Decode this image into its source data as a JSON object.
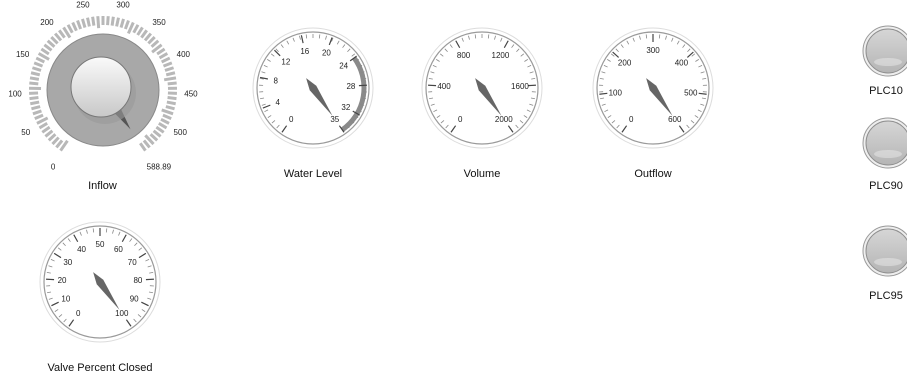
{
  "knob": {
    "caption": "Inflow",
    "min": 0,
    "max": 588.89,
    "value": 588.89,
    "min_label": "0",
    "max_label": "588.89",
    "ticks": [
      "50",
      "100",
      "150",
      "200",
      "250",
      "300",
      "350",
      "400",
      "450",
      "500"
    ]
  },
  "gauges": [
    {
      "caption": "Water Level",
      "min": 0,
      "max": 35,
      "value": 35,
      "ticks": [
        "0",
        "4",
        "8",
        "12",
        "16",
        "20",
        "24",
        "28",
        "32",
        "35"
      ],
      "band": [
        24,
        35
      ]
    },
    {
      "caption": "Volume",
      "min": 0,
      "max": 2000,
      "value": 2000,
      "ticks": [
        "0",
        "400",
        "800",
        "1200",
        "1600",
        "2000"
      ]
    },
    {
      "caption": "Outflow",
      "min": 0,
      "max": 600,
      "value": 600,
      "ticks": [
        "0",
        "100",
        "200",
        "300",
        "400",
        "500",
        "600"
      ]
    },
    {
      "caption": "Valve Percent Closed",
      "min": 0,
      "max": 100,
      "value": 100,
      "ticks": [
        "0",
        "10",
        "20",
        "30",
        "40",
        "50",
        "60",
        "70",
        "80",
        "90",
        "100"
      ]
    }
  ],
  "lamps": [
    {
      "label": "PLC10",
      "state": "off"
    },
    {
      "label": "PLC90",
      "state": "off"
    },
    {
      "label": "PLC95",
      "state": "off"
    }
  ],
  "colors": {
    "lamp_off": "#b5b5b5",
    "dial_fill": "#a8a8a8",
    "needle": "#666666"
  }
}
